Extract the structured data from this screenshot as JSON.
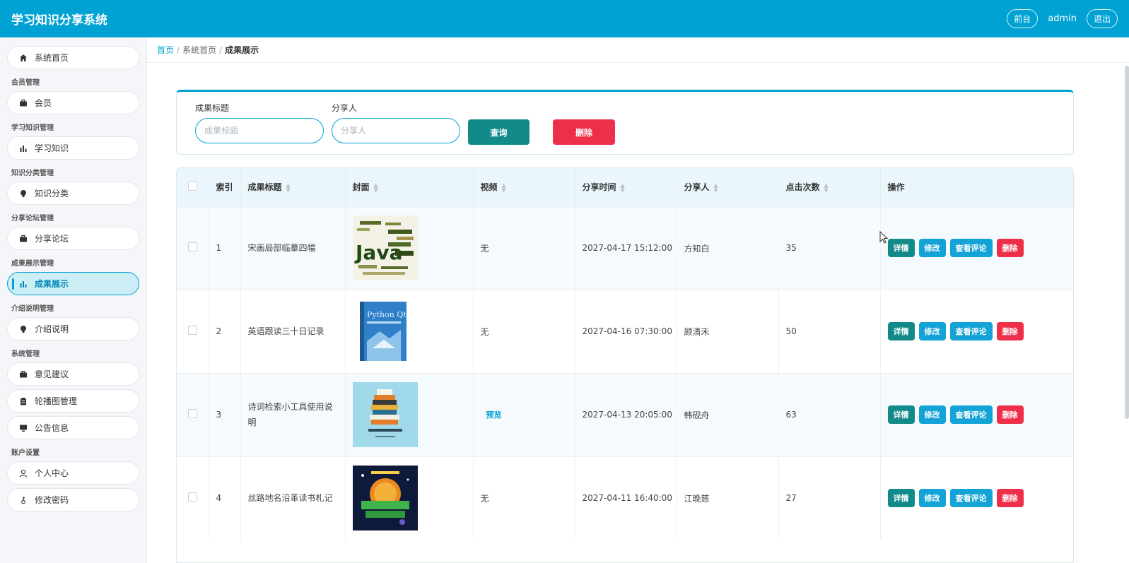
{
  "header": {
    "title": "学习知识分享系统",
    "front_label": "前台",
    "user": "admin",
    "logout_label": "退出"
  },
  "sidebar": {
    "home": "系统首页",
    "groups": [
      {
        "title": "会员管理",
        "items": [
          "会员"
        ]
      },
      {
        "title": "学习知识管理",
        "items": [
          "学习知识"
        ]
      },
      {
        "title": "知识分类管理",
        "items": [
          "知识分类"
        ]
      },
      {
        "title": "分享论坛管理",
        "items": [
          "分享论坛"
        ]
      },
      {
        "title": "成果展示管理",
        "items": [
          "成果展示"
        ]
      },
      {
        "title": "介绍说明管理",
        "items": [
          "介绍说明"
        ]
      },
      {
        "title": "系统管理",
        "items": [
          "意见建议",
          "轮播图管理",
          "公告信息"
        ]
      },
      {
        "title": "账户设置",
        "items": [
          "个人中心",
          "修改密码"
        ]
      }
    ]
  },
  "breadcrumb": {
    "home": "首页",
    "parent": "系统首页",
    "current": "成果展示"
  },
  "search": {
    "title_label": "成果标题",
    "title_placeholder": "成果标题",
    "sharer_label": "分享人",
    "sharer_placeholder": "分享人",
    "query_label": "查询",
    "delete_label": "删除"
  },
  "table": {
    "columns": [
      "索引",
      "成果标题",
      "封面",
      "视频",
      "分享时间",
      "分享人",
      "点击次数",
      "操作"
    ],
    "actions": {
      "detail": "详情",
      "edit": "修改",
      "comments": "查看评论",
      "delete": "删除"
    },
    "rows": [
      {
        "index": "1",
        "title": "宋画局部临摹四幅",
        "cover": "java-wordcloud",
        "video": "无",
        "time": "2027-04-17 15:12:00",
        "sharer": "方知白",
        "clicks": "35"
      },
      {
        "index": "2",
        "title": "英语跟读三十日记录",
        "cover": "python-qt-book",
        "video": "无",
        "time": "2027-04-16 07:30:00",
        "sharer": "顾清禾",
        "clicks": "50"
      },
      {
        "index": "3",
        "title": "诗词检索小工具使用说明",
        "cover": "book-stack",
        "video": "预览",
        "time": "2027-04-13 20:05:00",
        "sharer": "韩砚舟",
        "clicks": "63"
      },
      {
        "index": "4",
        "title": "丝路地名沿革读书札记",
        "cover": "space-poster",
        "video": "无",
        "time": "2027-04-11 16:40:00",
        "sharer": "江晚慈",
        "clicks": "27"
      }
    ]
  },
  "colors": {
    "primary": "#00a2d3",
    "teal": "#138a8a",
    "danger": "#ee2f4a"
  }
}
